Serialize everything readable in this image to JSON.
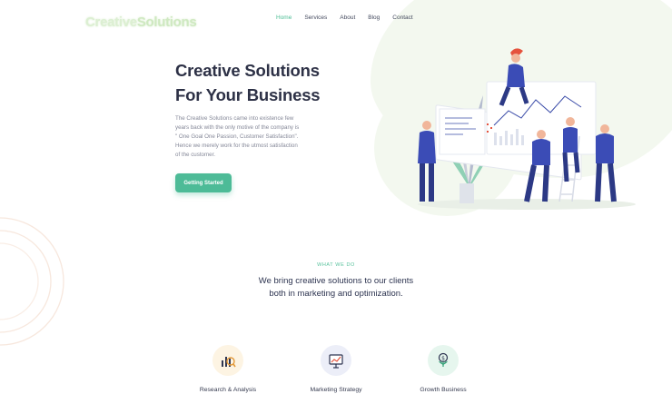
{
  "logo": {
    "part1": "Creative",
    "part2": "Solutions"
  },
  "nav": {
    "items": [
      {
        "label": "Home",
        "active": true
      },
      {
        "label": "Services",
        "active": false
      },
      {
        "label": "About",
        "active": false
      },
      {
        "label": "Blog",
        "active": false
      },
      {
        "label": "Contact",
        "active": false
      }
    ]
  },
  "hero": {
    "title_line1": "Creative Solutions",
    "title_line2": "For Your Business",
    "description_lines": [
      "The Creative Solutions came into existence few",
      "years back with the only motive of the company is",
      "\" One Goal One Passion, Customer Satisfaction\".",
      "Hence we merely work for the utmost satisfaction",
      "of the customer."
    ],
    "cta_label": "Getting Started"
  },
  "section": {
    "kicker": "WHAT WE DO",
    "title_line1": "We bring creative solutions to our clients",
    "title_line2": "both in marketing and optimization."
  },
  "services": [
    {
      "label": "Research & Analysis",
      "icon": "research-analysis-icon",
      "bg": "#fdf4e3"
    },
    {
      "label": "Marketing Strategy",
      "icon": "presentation-board-icon",
      "bg": "#eceef8"
    },
    {
      "label": "Growth Business",
      "icon": "money-plant-icon",
      "bg": "#e6f6ee"
    }
  ],
  "colors": {
    "accent": "#4dbb97",
    "title": "#2d3146",
    "illustration_blue": "#2f3e9e",
    "illustration_red": "#e5533d"
  }
}
